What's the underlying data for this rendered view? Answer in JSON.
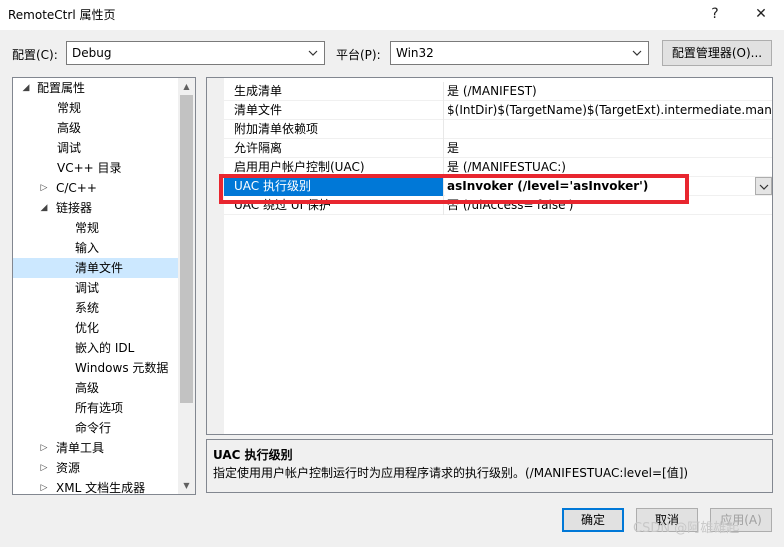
{
  "window": {
    "title": "RemoteCtrl 属性页",
    "help_glyph": "?",
    "close_glyph": "✕"
  },
  "toolbar": {
    "config_label": "配置(C):",
    "config_value": "Debug",
    "platform_label": "平台(P):",
    "platform_value": "Win32",
    "config_manager_label": "配置管理器(O)..."
  },
  "tree": {
    "items": [
      {
        "label": "配置属性",
        "toggle": "◢"
      },
      {
        "label": "常规"
      },
      {
        "label": "高级"
      },
      {
        "label": "调试"
      },
      {
        "label": "VC++ 目录"
      },
      {
        "label": "C/C++",
        "toggle": "▷"
      },
      {
        "label": "链接器",
        "toggle": "◢"
      },
      {
        "label": "常规"
      },
      {
        "label": "输入"
      },
      {
        "label": "清单文件"
      },
      {
        "label": "调试"
      },
      {
        "label": "系统"
      },
      {
        "label": "优化"
      },
      {
        "label": "嵌入的 IDL"
      },
      {
        "label": "Windows 元数据"
      },
      {
        "label": "高级"
      },
      {
        "label": "所有选项"
      },
      {
        "label": "命令行"
      },
      {
        "label": "清单工具",
        "toggle": "▷"
      },
      {
        "label": "资源",
        "toggle": "▷"
      },
      {
        "label": "XML 文档生成器",
        "toggle": "▷"
      }
    ]
  },
  "grid": {
    "rows": [
      {
        "name": "生成清单",
        "value": "是 (/MANIFEST)"
      },
      {
        "name": "清单文件",
        "value": "$(IntDir)$(TargetName)$(TargetExt).intermediate.manifest"
      },
      {
        "name": "附加清单依赖项",
        "value": ""
      },
      {
        "name": "允许隔离",
        "value": "是"
      },
      {
        "name": "启用用户帐户控制(UAC)",
        "value": "是 (/MANIFESTUAC:)"
      },
      {
        "name": "UAC 执行级别",
        "value": "asInvoker (/level='asInvoker')"
      },
      {
        "name": "UAC 绕过 UI 保护",
        "value": "否 (/uiAccess='false')"
      }
    ]
  },
  "description": {
    "heading": "UAC 执行级别",
    "text": "指定使用用户帐户控制运行时为应用程序请求的执行级别。(/MANIFESTUAC:level=[值])"
  },
  "buttons": {
    "ok": "确定",
    "cancel": "取消",
    "apply": "应用(A)"
  },
  "watermark": "CSDN @阿雄雄起",
  "colors": {
    "selection": "#0078d7",
    "highlight_border": "#e8262f",
    "tree_selection": "#cce8ff"
  }
}
